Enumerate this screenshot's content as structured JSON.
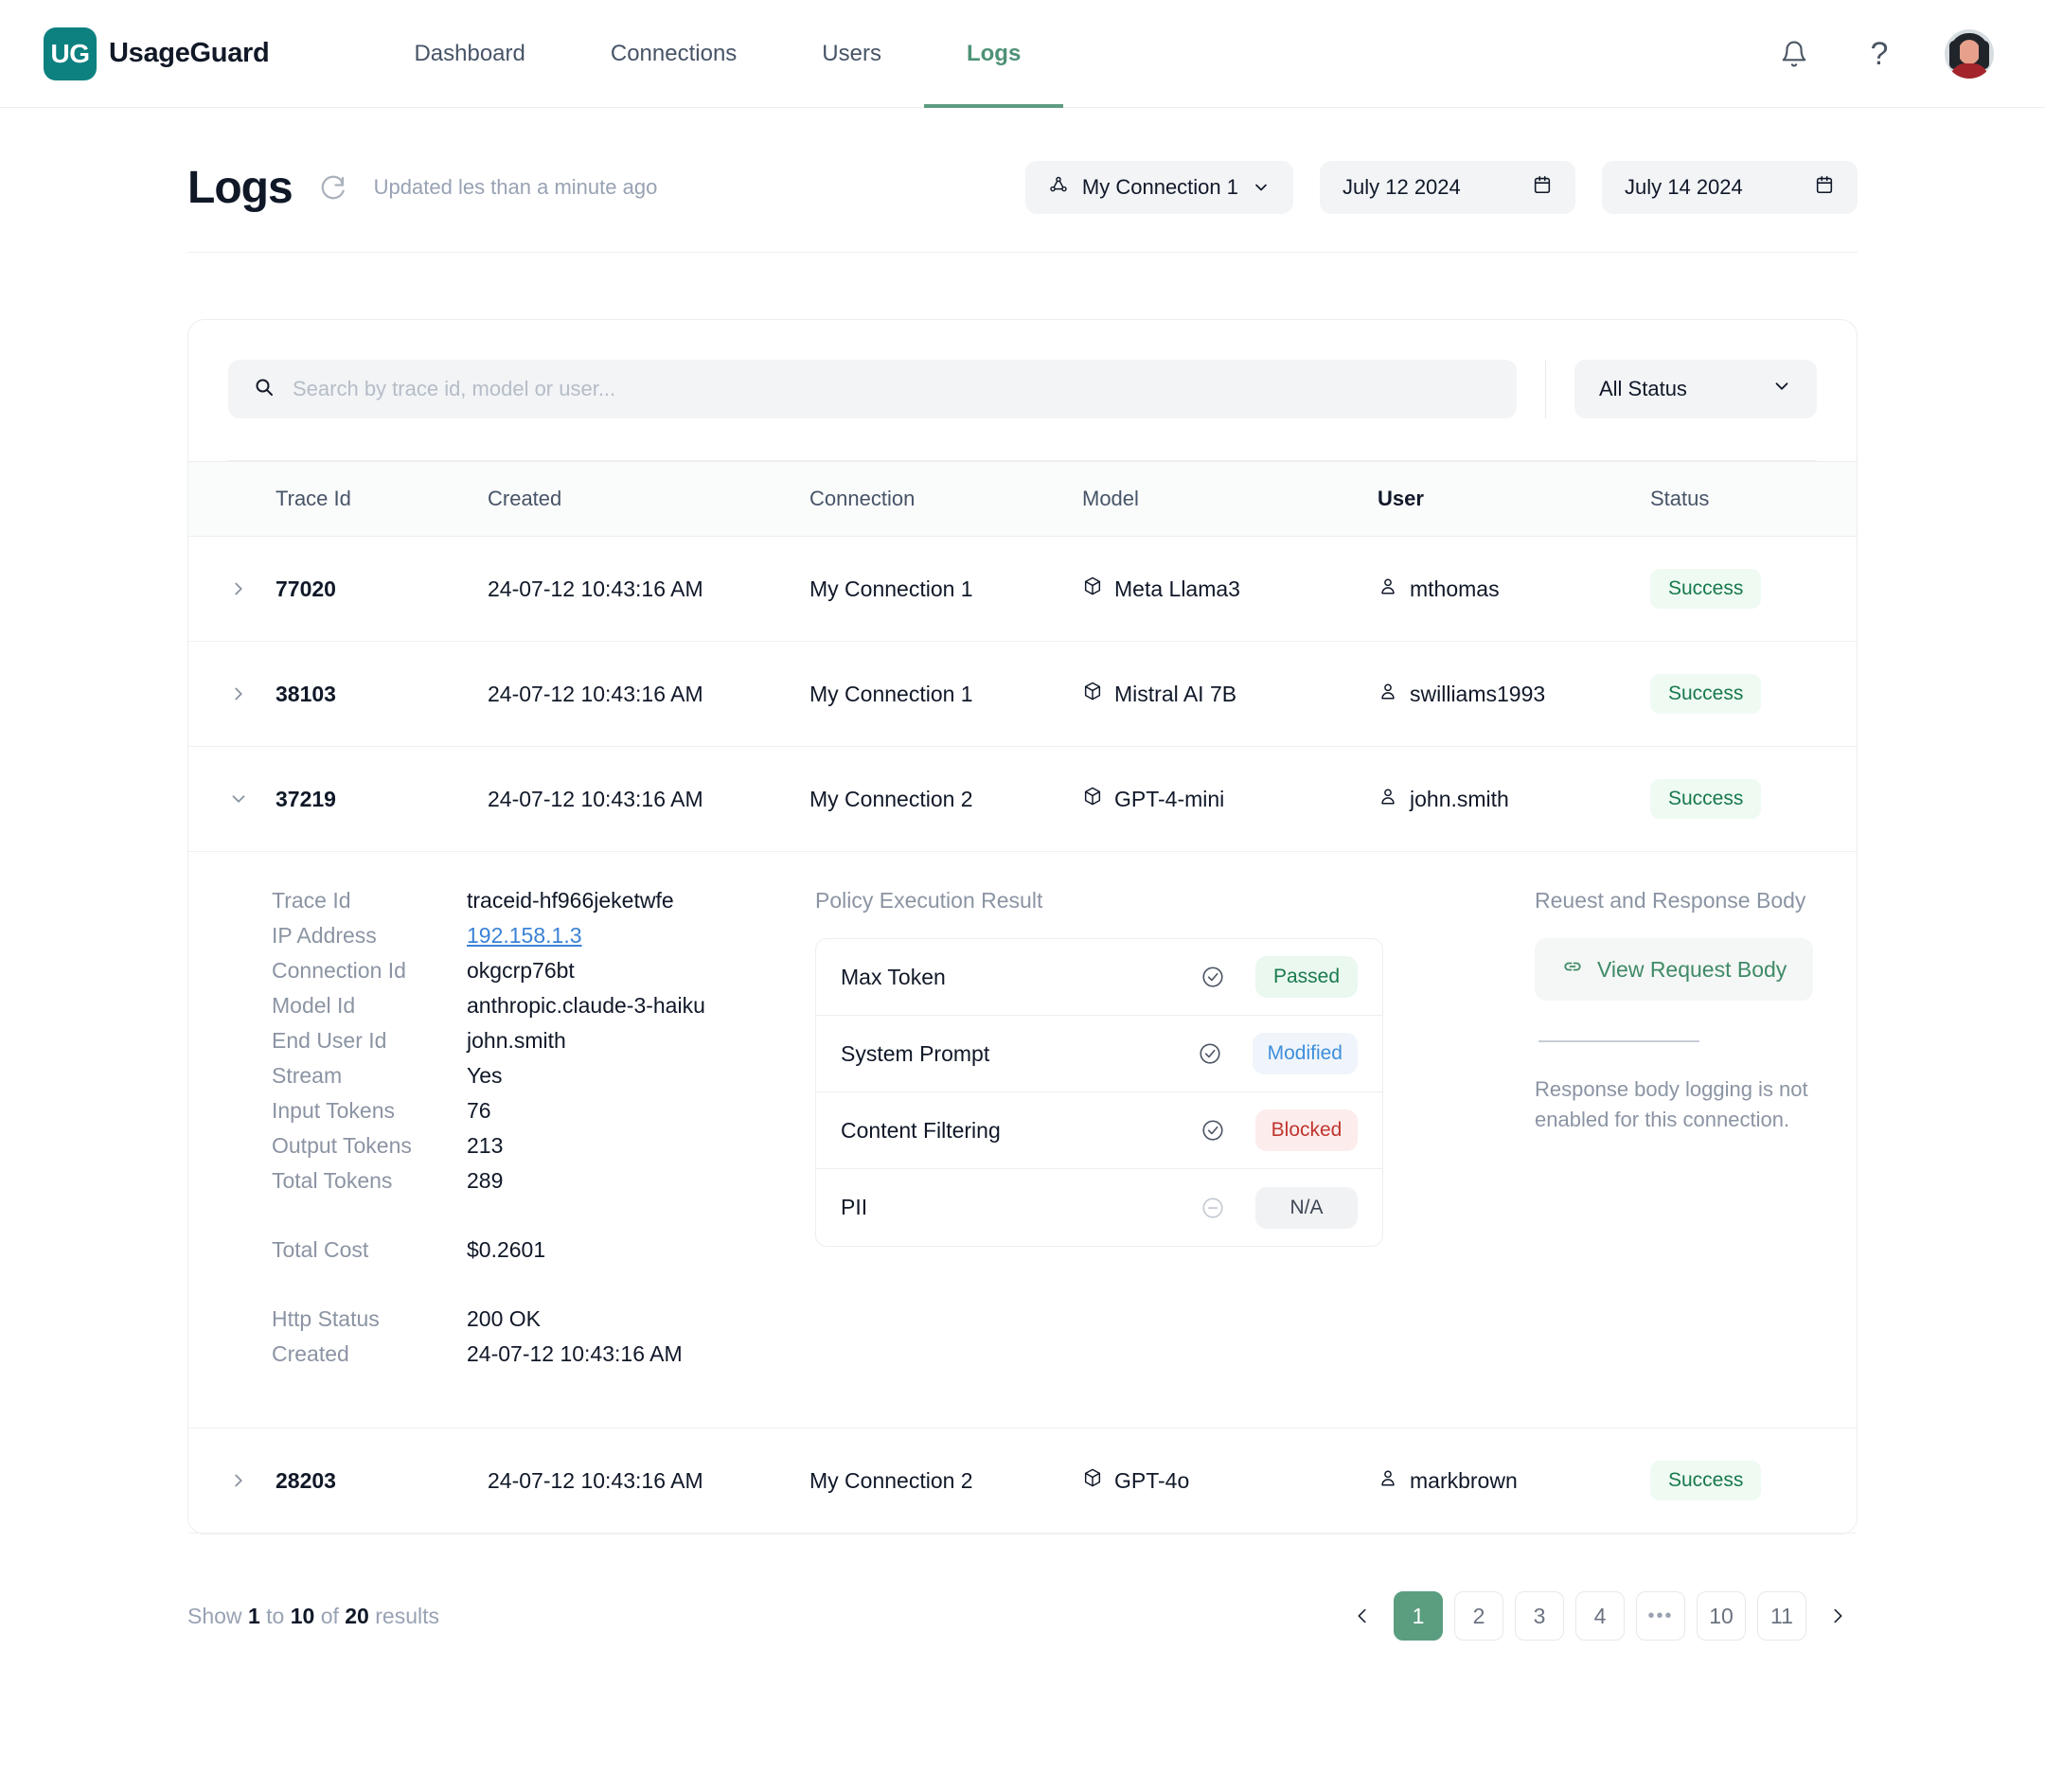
{
  "brand": {
    "logo_text": "UG",
    "name": "UsageGuard"
  },
  "nav": {
    "items": [
      {
        "label": "Dashboard",
        "active": false
      },
      {
        "label": "Connections",
        "active": false
      },
      {
        "label": "Users",
        "active": false
      },
      {
        "label": "Logs",
        "active": true
      }
    ],
    "notifications_icon": "bell-icon",
    "help_icon": "question-mark-icon",
    "avatar_icon": "user-avatar"
  },
  "page": {
    "title": "Logs",
    "refresh_icon": "refresh-icon",
    "updated_text": "Updated les than a minute ago"
  },
  "filters": {
    "connection": {
      "label": "My Connection 1",
      "icon": "network-nodes-icon",
      "chevron": "chevron-down-icon"
    },
    "date_from": {
      "value": "July 12 2024",
      "icon": "calendar-icon"
    },
    "date_to": {
      "value": "July 14 2024",
      "icon": "calendar-icon"
    }
  },
  "search": {
    "placeholder": "Search by trace id, model or user...",
    "value": "",
    "icon": "search-icon"
  },
  "status_filter": {
    "value": "All Status",
    "chevron": "chevron-down-icon"
  },
  "table": {
    "columns": [
      "Trace Id",
      "Created",
      "Connection",
      "Model",
      "User",
      "Status"
    ],
    "rows": [
      {
        "trace_id": "77020",
        "created": "24-07-12 10:43:16 AM",
        "connection": "My Connection 1",
        "model": "Meta Llama3",
        "user": "mthomas",
        "status": "Success",
        "expanded": false
      },
      {
        "trace_id": "38103",
        "created": "24-07-12 10:43:16 AM",
        "connection": "My Connection 1",
        "model": "Mistral AI 7B",
        "user": "swilliams1993",
        "status": "Success",
        "expanded": false
      },
      {
        "trace_id": "37219",
        "created": "24-07-12 10:43:16 AM",
        "connection": "My Connection 2",
        "model": "GPT-4-mini",
        "user": "john.smith",
        "status": "Success",
        "expanded": true
      },
      {
        "trace_id": "28203",
        "created": "24-07-12 10:43:16 AM",
        "connection": "My Connection 2",
        "model": "GPT-4o",
        "user": "markbrown",
        "status": "Success",
        "expanded": false
      }
    ]
  },
  "detail": {
    "fields": [
      {
        "label": "Trace Id",
        "value": "traceid-hf966jeketwfe",
        "link": false
      },
      {
        "label": "IP Address",
        "value": "192.158.1.3",
        "link": true
      },
      {
        "label": "Connection Id",
        "value": "okgcrp76bt",
        "link": false
      },
      {
        "label": "Model Id",
        "value": "anthropic.claude-3-haiku",
        "link": false
      },
      {
        "label": "End User Id",
        "value": "john.smith",
        "link": false
      },
      {
        "label": "Stream",
        "value": "Yes",
        "link": false
      },
      {
        "label": "Input Tokens",
        "value": "76",
        "link": false
      },
      {
        "label": "Output Tokens",
        "value": "213",
        "link": false
      },
      {
        "label": "Total Tokens",
        "value": "289",
        "link": false
      }
    ],
    "cost": {
      "label": "Total Cost",
      "value": "$0.2601"
    },
    "http": [
      {
        "label": "Http Status",
        "value": "200 OK"
      },
      {
        "label": "Created",
        "value": "24-07-12 10:43:16 AM"
      }
    ],
    "policy": {
      "title": "Policy Execution Result",
      "rows": [
        {
          "name": "Max Token",
          "icon": "check-circle-icon",
          "badge": "Passed",
          "badge_style": "pb-passed"
        },
        {
          "name": "System Prompt",
          "icon": "check-circle-icon",
          "badge": "Modified",
          "badge_style": "pb-modified"
        },
        {
          "name": "Content Filtering",
          "icon": "check-circle-icon",
          "badge": "Blocked",
          "badge_style": "pb-blocked"
        },
        {
          "name": "PII",
          "icon": "minus-circle-icon",
          "badge": "N/A",
          "badge_style": "pb-na"
        }
      ]
    },
    "body_panel": {
      "title": "Reuest and Response Body",
      "button_label": "View Request Body",
      "button_icon": "link-icon",
      "note": "Response body logging is not enabled for this connection."
    }
  },
  "footer": {
    "results_prefix": "Show",
    "results_from": "1",
    "results_to_word": "to",
    "results_to": "10",
    "results_of_word": "of",
    "results_total": "20",
    "results_suffix": "results",
    "prev_icon": "chevron-left-icon",
    "next_icon": "chevron-right-icon",
    "pages": [
      "1",
      "2",
      "3",
      "4",
      "•••",
      "10",
      "11"
    ],
    "active_page": "1"
  },
  "colors": {
    "brand_teal": "#0d8080",
    "accent_green": "#5a9e7f",
    "nav_active": "#4e9276",
    "success_text": "#17794b",
    "success_bg": "#effaf3",
    "link_blue": "#3b82d6",
    "blocked_red": "#c0352f",
    "modified_blue": "#3e8fdc"
  }
}
